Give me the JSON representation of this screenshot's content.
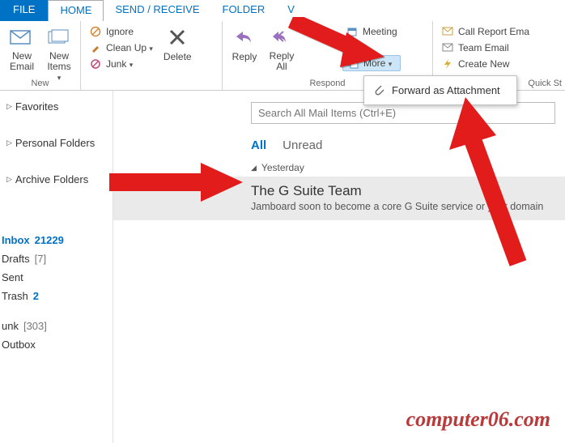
{
  "tabs": {
    "file": "FILE",
    "home": "HOME",
    "send_receive": "SEND / RECEIVE",
    "folder": "FOLDER",
    "v": "V"
  },
  "ribbon": {
    "new": {
      "label": "New",
      "new_email": "New\nEmail",
      "new_items": "New\nItems"
    },
    "delete": {
      "ignore": "Ignore",
      "clean_up": "Clean Up",
      "junk": "Junk",
      "delete": "Delete"
    },
    "respond": {
      "label": "Respond",
      "reply": "Reply",
      "reply_all": "Reply\nAll",
      "more": "More",
      "meeting": "Meeting"
    },
    "quick": {
      "label": "Quick St",
      "call_report": "Call Report Ema",
      "team_email": "Team Email",
      "create_new": "Create New"
    }
  },
  "dropdown": {
    "forward_attachment": "Forward as Attachment"
  },
  "sidebar": {
    "favorites": "Favorites",
    "personal": "Personal Folders",
    "archive": "Archive Folders",
    "folders": {
      "inbox": {
        "name": "Inbox",
        "count": "21229"
      },
      "drafts": {
        "name": "Drafts",
        "count": "[7]"
      },
      "sent": {
        "name": "Sent"
      },
      "trash": {
        "name": "Trash",
        "count": "2"
      },
      "junk": {
        "name": "unk",
        "count": "[303]"
      },
      "outbox": {
        "name": "Outbox"
      }
    }
  },
  "content": {
    "search_placeholder": "Search All Mail Items (Ctrl+E)",
    "filter_all": "All",
    "filter_unread": "Unread",
    "group_yesterday": "Yesterday",
    "message": {
      "from": "The G Suite Team",
      "subject": "Jamboard soon to become a core G Suite service or your domain"
    }
  },
  "watermark": "computer06.com"
}
